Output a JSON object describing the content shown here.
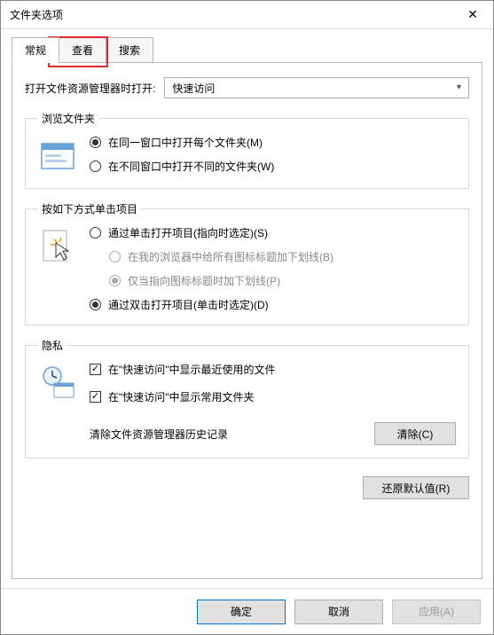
{
  "window": {
    "title": "文件夹选项"
  },
  "tabs": {
    "general": "常规",
    "view": "查看",
    "search": "搜索"
  },
  "openWith": {
    "label": "打开文件资源管理器时打开:",
    "value": "快速访问"
  },
  "browse": {
    "legend": "浏览文件夹",
    "sameWindow": "在同一窗口中打开每个文件夹(M)",
    "newWindow": "在不同窗口中打开不同的文件夹(W)"
  },
  "click": {
    "legend": "按如下方式单击项目",
    "single": "通过单击打开项目(指向时选定)(S)",
    "underlineBrowser": "在我的浏览器中给所有图标标题加下划线(B)",
    "underlinePoint": "仅当指向图标标题时加下划线(P)",
    "double": "通过双击打开项目(单击时选定)(D)"
  },
  "privacy": {
    "legend": "隐私",
    "showRecent": "在\"快速访问\"中显示最近使用的文件",
    "showFrequent": "在\"快速访问\"中显示常用文件夹",
    "clearLabel": "清除文件资源管理器历史记录",
    "clearBtn": "清除(C)"
  },
  "restoreBtn": "还原默认值(R)",
  "footer": {
    "ok": "确定",
    "cancel": "取消",
    "apply": "应用(A)"
  }
}
